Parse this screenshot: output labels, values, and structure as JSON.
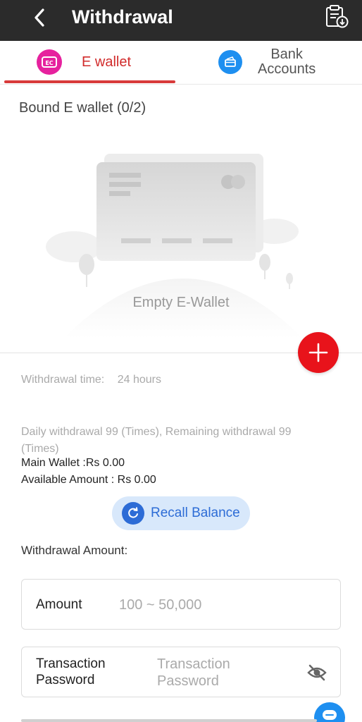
{
  "header": {
    "title": "Withdrawal",
    "back_icon": "chevron-left-icon",
    "history_icon": "clipboard-history-icon"
  },
  "tabs": [
    {
      "label": "E wallet",
      "icon": "ewallet-icon",
      "active": true,
      "color": "#d12b2b"
    },
    {
      "label_line1": "Bank",
      "label_line2": "Accounts",
      "icon": "bank-card-icon",
      "active": false
    }
  ],
  "bound": {
    "title": "Bound E wallet (0/2)",
    "empty_label": "Empty E-Wallet"
  },
  "info": {
    "withdrawal_time_label": "Withdrawal time:",
    "withdrawal_time_value": "24 hours",
    "daily_text": "Daily withdrawal 99 (Times), Remaining withdrawal 99 (Times)",
    "main_wallet": "Main Wallet :Rs 0.00",
    "available_amount": "Available Amount : Rs 0.00"
  },
  "recall": {
    "label": "Recall Balance",
    "icon": "refresh-icon"
  },
  "form": {
    "title": "Withdrawal Amount:",
    "amount_label": "Amount",
    "amount_placeholder": "100 ~ 50,000",
    "pwd_label_line1": "Transaction",
    "pwd_label_line2": "Password",
    "pwd_placeholder_line1": "Transaction",
    "pwd_placeholder_line2": "Password",
    "eye_icon": "eye-off-icon"
  },
  "colors": {
    "header_bg": "#2b2b2b",
    "accent_red": "#e8131b",
    "ewallet_pink": "#e6219e",
    "bank_blue": "#1e8ff0",
    "recall_bg": "#d8e8fb"
  }
}
